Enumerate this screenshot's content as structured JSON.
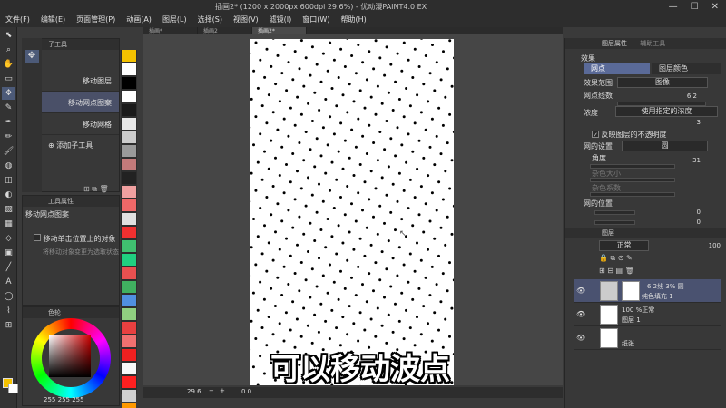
{
  "window": {
    "title": "插画2* (1200 x 2000px 600dpi 29.6%) - 优动漫PAINT4.0 EX"
  },
  "menu": [
    "文件(F)",
    "编辑(E)",
    "页面管理(P)",
    "动画(A)",
    "图层(L)",
    "选择(S)",
    "视图(V)",
    "滤镜(I)",
    "窗口(W)",
    "帮助(H)"
  ],
  "tabs": [
    "插画*",
    "插画2",
    "插画2*"
  ],
  "subtool": {
    "panel_title": "子工具",
    "items": [
      "移动图层",
      "移动网点图案",
      "移动网格"
    ],
    "add_label": "添加子工具"
  },
  "tool_property": {
    "panel_title": "工具属性",
    "name": "移动网点图案",
    "option1": "移动单击位置上的对象",
    "option2": "将移动对象变更为选取状态"
  },
  "color_panel": {
    "title": "色轮",
    "values": [
      "255",
      "255",
      "255"
    ]
  },
  "layer_property": {
    "tab1": "图层属性",
    "tab2": "辅助工具",
    "effect_label": "效果",
    "effect_btn1": "网点",
    "effect_btn2": "图层颜色",
    "range_label": "效果范围",
    "range_value": "图像",
    "lines_label": "网点线数",
    "lines_value": "6.2",
    "density_label": "浓度",
    "density_value": "使用指定的浓度",
    "density_num": "3",
    "reflect_label": "反映图层的不透明度",
    "settings_label": "网的设置",
    "settings_value": "圆",
    "angle_label": "角度",
    "angle_value": "31",
    "noise_size": "杂色大小",
    "noise_coef": "杂色系数",
    "position_label": "网的位置",
    "pos_x": "0",
    "pos_y": "0"
  },
  "layers": {
    "tab1": "图层",
    "blend": "正常",
    "opacity": "100",
    "rows": [
      {
        "line1": "6.2线 3% 圆",
        "line2": "纯色填充 1"
      },
      {
        "line1": "100 %正常",
        "line2": "图层 1"
      },
      {
        "line1": "",
        "line2": "纸张"
      }
    ]
  },
  "status": {
    "zoom": "29.6",
    "angle": "0.0"
  },
  "caption": "可以移动波点",
  "colors": {
    "swatches": [
      "#f4c200",
      "#ffffff",
      "#000000",
      "#ffffff",
      "#1a1a1a",
      "#e8e8e8",
      "#cccccc",
      "#9a9a9a",
      "#c37a7a",
      "#222222",
      "#f0a0a0",
      "#f06868",
      "#e0e0e0",
      "#f03030",
      "#40c070",
      "#20d080",
      "#e85050",
      "#40b060",
      "#5090e0",
      "#90d080",
      "#e84040",
      "#f07070",
      "#f02020",
      "#f8f8f8",
      "#ff2020",
      "#d0d0d0",
      "#ff9900"
    ]
  }
}
